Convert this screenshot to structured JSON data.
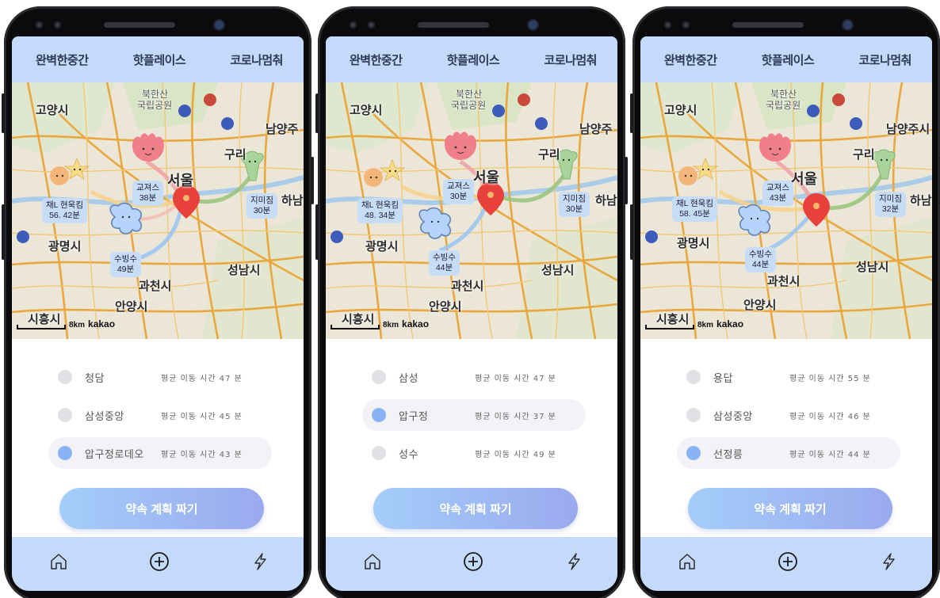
{
  "screens": [
    {
      "tabs": [
        "완벽한중간",
        "핫플레이스",
        "코로나멈춰"
      ],
      "map": {
        "cities": {
          "goyang": "고양시",
          "bukhansan": "북한산",
          "national_park": "국립공원",
          "namyangju": "남양주",
          "guri": "구리",
          "seoul": "서울",
          "hanam": "하남시",
          "gwangmyeong": "광명시",
          "seongnam": "성남시",
          "gwacheon": "과천시",
          "anyang": "안양시",
          "siheung": "시흥시"
        },
        "bubbles": {
          "gyojeoseu_name": "교져스",
          "gyojeoseu_time": "38분",
          "jimijeom_name": "지미짐",
          "jimijeom_time": "30분",
          "chaehyunwook_name": "채L 현욱킴",
          "chaehyunwook_time": "56. 42분",
          "subingsu_name": "수빙수",
          "subingsu_time": "49분"
        },
        "scale_km": "8km",
        "brand": "kakao"
      },
      "options": [
        {
          "station": "청담",
          "avg": "평균 이동 시간 47 분",
          "selected": false
        },
        {
          "station": "삼성중앙",
          "avg": "평균 이동 시간 45 분",
          "selected": false
        },
        {
          "station": "압구정로데오",
          "avg": "평균 이동 시간 43 분",
          "selected": true
        }
      ],
      "cta": "약속 계획 짜기"
    },
    {
      "tabs": [
        "완벽한중간",
        "핫플레이스",
        "코로나멈춰"
      ],
      "map": {
        "cities": {
          "goyang": "고양시",
          "bukhansan": "북한산",
          "national_park": "국립공원",
          "namyangju": "남양주",
          "guri": "구리",
          "seoul": "서울",
          "hanam": "하남시",
          "gwangmyeong": "광명시",
          "seongnam": "성남시",
          "gwacheon": "과천시",
          "anyang": "안양시",
          "siheung": "시흥시"
        },
        "bubbles": {
          "gyojeoseu_name": "교져스",
          "gyojeoseu_time": "30분",
          "jimijeom_name": "지미짐",
          "jimijeom_time": "30분",
          "chaehyunwook_name": "채L 현욱킴",
          "chaehyunwook_time": "48. 34분",
          "subingsu_name": "수빙수",
          "subingsu_time": "44분"
        },
        "scale_km": "8km",
        "brand": "kakao"
      },
      "options": [
        {
          "station": "삼성",
          "avg": "평균 이동 시간 47 분",
          "selected": false
        },
        {
          "station": "압구정",
          "avg": "평균 이동 시간 37 분",
          "selected": true
        },
        {
          "station": "성수",
          "avg": "평균 이동 시간 49 분",
          "selected": false
        }
      ],
      "cta": "약속 계획 짜기"
    },
    {
      "tabs": [
        "완벽한중간",
        "핫플레이스",
        "코로나멈춰"
      ],
      "map": {
        "cities": {
          "goyang": "고양시",
          "bukhansan": "북한산",
          "national_park": "국립공원",
          "namyangju": "남양주시",
          "guri": "구리",
          "seoul": "서울",
          "hanam": "하남시",
          "gwangmyeong": "광명시",
          "seongnam": "성남시",
          "gwacheon": "과천시",
          "anyang": "안양시",
          "siheung": "시흥시"
        },
        "bubbles": {
          "gyojeoseu_name": "교져스",
          "gyojeoseu_time": "43분",
          "jimijeom_name": "지미짐",
          "jimijeom_time": "32분",
          "chaehyunwook_name": "채L 현욱킴",
          "chaehyunwook_time": "58. 45분",
          "subingsu_name": "수빙수",
          "subingsu_time": "44분"
        },
        "scale_km": "8km",
        "brand": "kakao"
      },
      "options": [
        {
          "station": "용답",
          "avg": "평균 이동 시간 55 분",
          "selected": false
        },
        {
          "station": "삼성중앙",
          "avg": "평균 이동 시간 46 분",
          "selected": false
        },
        {
          "station": "선정릉",
          "avg": "평균 이동 시간 44 분",
          "selected": true
        }
      ],
      "cta": "약속 계획 짜기"
    }
  ],
  "colors": {
    "tab_bg": "#c4dafb",
    "radio_selected": "#8ab3f3",
    "cta_from": "#a4cdfa",
    "cta_to": "#9aa9ee"
  },
  "icons": {
    "nav_home": "home-icon",
    "nav_add": "plus-circle-icon",
    "nav_lightning": "lightning-icon",
    "pin": "map-pin-icon"
  }
}
